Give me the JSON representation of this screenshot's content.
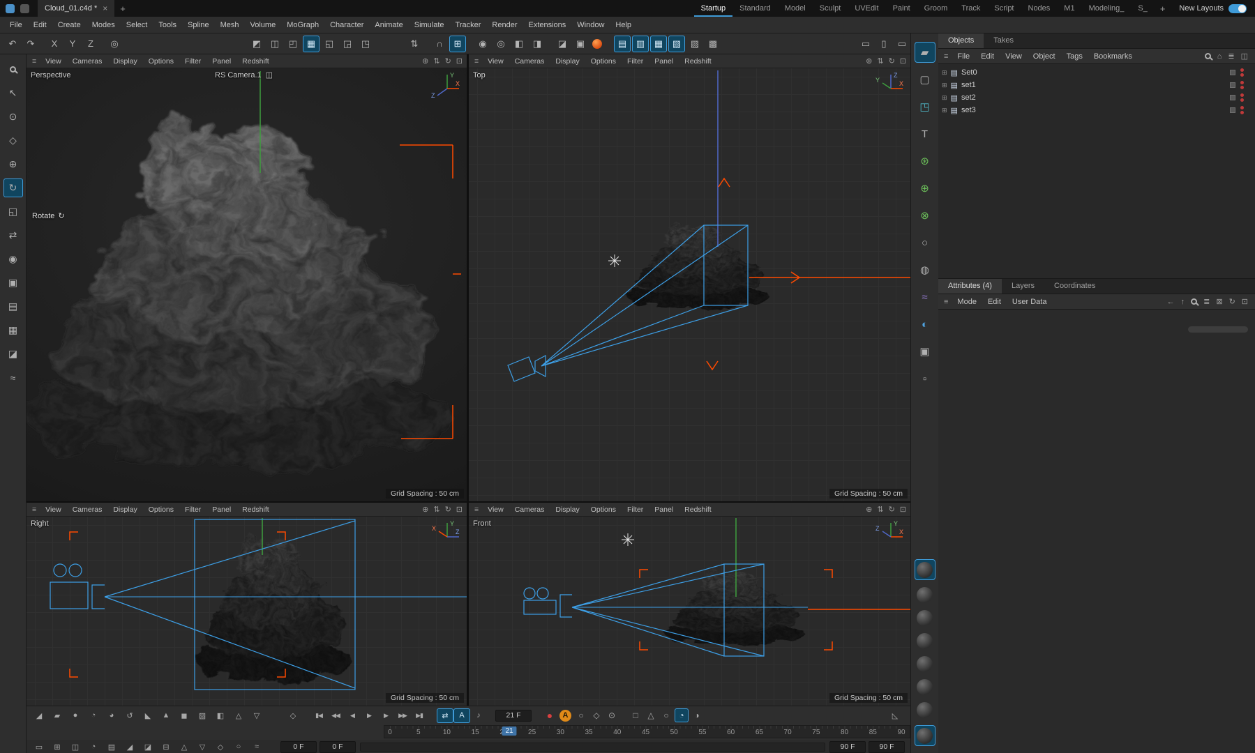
{
  "titlebar": {
    "document_tab": "Cloud_01.c4d *",
    "close_glyph": "×",
    "add_tab_glyph": "+",
    "layout_tabs": [
      {
        "label": "Startup",
        "active": true
      },
      {
        "label": "Standard"
      },
      {
        "label": "Model"
      },
      {
        "label": "Sculpt"
      },
      {
        "label": "UVEdit"
      },
      {
        "label": "Paint"
      },
      {
        "label": "Groom"
      },
      {
        "label": "Track"
      },
      {
        "label": "Script"
      },
      {
        "label": "Nodes"
      },
      {
        "label": "M1"
      },
      {
        "label": "Modeling_"
      },
      {
        "label": "S_"
      }
    ],
    "new_layouts_label": "New Layouts"
  },
  "menubar": {
    "items": [
      "File",
      "Edit",
      "Create",
      "Modes",
      "Select",
      "Tools",
      "Spline",
      "Mesh",
      "Volume",
      "MoGraph",
      "Character",
      "Animate",
      "Simulate",
      "Tracker",
      "Render",
      "Extensions",
      "Window",
      "Help"
    ]
  },
  "axes": {
    "x": "X",
    "y": "Y",
    "z": "Z"
  },
  "viewport_menu": [
    "View",
    "Cameras",
    "Display",
    "Options",
    "Filter",
    "Panel",
    "Redshift"
  ],
  "viewports": {
    "perspective": {
      "label": "Perspective",
      "camera_label": "RS Camera.1",
      "tool_hint": "Rotate",
      "grid_spacing": "Grid Spacing : 50 cm"
    },
    "top": {
      "label": "Top",
      "grid_spacing": "Grid Spacing : 50 cm"
    },
    "right": {
      "label": "Right",
      "grid_spacing": "Grid Spacing : 50 cm"
    },
    "front": {
      "label": "Front",
      "grid_spacing": "Grid Spacing : 50 cm"
    }
  },
  "object_manager": {
    "tabs": [
      {
        "label": "Objects",
        "active": true
      },
      {
        "label": "Takes"
      }
    ],
    "menu": [
      "File",
      "Edit",
      "View",
      "Object",
      "Tags",
      "Bookmarks"
    ],
    "objects": [
      {
        "name": "Set0"
      },
      {
        "name": "set1"
      },
      {
        "name": "set2"
      },
      {
        "name": "set3"
      }
    ]
  },
  "attribute_manager": {
    "tabs": [
      {
        "label": "Attributes (4)",
        "active": true
      },
      {
        "label": "Layers"
      },
      {
        "label": "Coordinates"
      }
    ],
    "menu": [
      "Mode",
      "Edit",
      "User Data"
    ]
  },
  "timeline": {
    "current_frame_field": "21 F",
    "playhead": 21,
    "min": 0,
    "max": 90,
    "ticks": [
      "0",
      "5",
      "10",
      "15",
      "20",
      "25",
      "30",
      "35",
      "40",
      "45",
      "50",
      "55",
      "60",
      "65",
      "70",
      "75",
      "80",
      "85",
      "90"
    ],
    "range_start_fields": [
      "0 F",
      "0 F"
    ],
    "range_end_fields": [
      "90 F",
      "90 F"
    ]
  },
  "colors": {
    "accent": "#3f9bd8",
    "axis_x": "#ff4a00",
    "axis_y": "#3e9e3e",
    "axis_z": "#5068c8",
    "autokey": "#e08a18",
    "record": "#c03a3a",
    "frustum": "#3da0e8"
  },
  "icons": {
    "hamburger": "≡",
    "coord_system": "◎",
    "loop": "⇄",
    "autokey_letter": "A",
    "speaker": "♪",
    "keyframe_diamond": "◇",
    "slope": "◺",
    "camera_chip": "◫",
    "rotate_hint": "↻",
    "home": "⌂",
    "list": "≣",
    "panel": "◫",
    "arrow_left": "←",
    "arrow_up": "↑",
    "lock": "⊠",
    "refresh": "↻",
    "maximize": "⊡",
    "expander": "⊞",
    "object": "▤",
    "plus": "+"
  },
  "icon_sets": {
    "toolbar_history": [
      "↶",
      "↷"
    ],
    "toolbar_axis": [
      "X",
      "Y",
      "Z"
    ],
    "toolbar_model": [
      "◩",
      "◫",
      "◰",
      {
        "label": "▦",
        "cls": "active"
      },
      "◱",
      "◲",
      "◳"
    ],
    "toolbar_arrows": [
      "⇅"
    ],
    "toolbar_snap": [
      "∩",
      {
        "label": "⊞",
        "cls": "active"
      }
    ],
    "toolbar_state": [
      "◉",
      "◎",
      "◧",
      "◨"
    ],
    "toolbar_render": [
      "◪",
      "▣"
    ],
    "toolbar_view": [
      {
        "label": "▤",
        "cls": "active"
      },
      {
        "label": "▥",
        "cls": "active"
      },
      {
        "label": "▦",
        "cls": "active"
      },
      {
        "label": "▧",
        "cls": "active"
      },
      "▨",
      "▩"
    ],
    "toolbar_screens": [
      "▭",
      "▯",
      "▭",
      "◍"
    ],
    "viewport_nav": [
      "⊕",
      "⇅",
      "↻",
      "⊡"
    ],
    "left_tools": [
      "↖",
      "⊙",
      "◇",
      "⊕",
      {
        "label": "↻",
        "cls": "active"
      },
      "◱",
      "⇄",
      "◉",
      "▣",
      "▤",
      "▦",
      "◪",
      "≈"
    ],
    "right_strip_top": [
      {
        "label": "▰",
        "cls": "active"
      },
      "▢",
      {
        "label": "◳",
        "cls": "teal"
      },
      "T",
      {
        "label": "⊛",
        "cls": "green"
      },
      {
        "label": "⊕",
        "cls": "green"
      },
      {
        "label": "⊗",
        "cls": "green"
      },
      "○",
      "◍",
      {
        "label": "≈",
        "cls": "purple"
      },
      {
        "label": "◐",
        "cls": "blue"
      },
      "▣",
      "▫"
    ],
    "media": [
      "▮◀",
      "◀◀",
      "◀",
      "▶",
      "▶",
      "▶▶",
      "▶▮"
    ],
    "record_group1": [
      {
        "label": "●",
        "cls": "rec"
      },
      {
        "label": "A",
        "cls": "autokey"
      },
      "○",
      "◇",
      "⊙"
    ],
    "record_group2": [
      "□",
      "△",
      "○",
      {
        "label": "◔",
        "cls": "active"
      },
      "◑"
    ],
    "bottom_tools_row1": [
      "◢",
      "▰",
      "●",
      "◔",
      "◕",
      "↺",
      "◣",
      "▲",
      "◼",
      "▨",
      "◧",
      "△",
      "▽"
    ],
    "bottom_tools_row2": [
      "▭",
      "⊞",
      "◫",
      "◔",
      "▤",
      "◢",
      "◪",
      "⊟",
      "△",
      "▽",
      "◇",
      "○",
      "≈"
    ]
  }
}
